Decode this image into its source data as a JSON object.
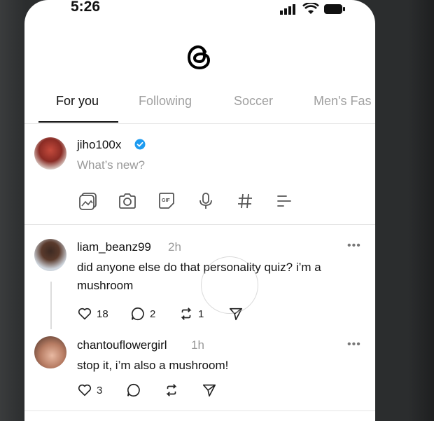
{
  "status_bar": {
    "time": "5:26"
  },
  "header": {
    "logo_icon": "threads-logo-icon"
  },
  "tabs": [
    {
      "label": "For you",
      "active": true
    },
    {
      "label": "Following",
      "active": false
    },
    {
      "label": "Soccer",
      "active": false
    },
    {
      "label": "Men's Fas",
      "active": false
    }
  ],
  "composer": {
    "username": "jiho100x",
    "verified": true,
    "placeholder": "What’s new?",
    "tools": [
      "image-icon",
      "camera-icon",
      "gif-icon",
      "mic-icon",
      "hashtag-icon",
      "poll-icon"
    ]
  },
  "posts": [
    {
      "username": "liam_beanz99",
      "time": "2h",
      "text": "did anyone else do that personality quiz? i’m a mushroom",
      "likes": "18",
      "replies": "2",
      "reposts": "1"
    },
    {
      "username": "chantouflowergirl",
      "time": "1h",
      "text": "stop it, i’m also a mushroom!",
      "likes": "3"
    }
  ],
  "colors": {
    "accent_verified": "#1d9bf0",
    "muted": "#9a9a9a",
    "text": "#111111"
  }
}
